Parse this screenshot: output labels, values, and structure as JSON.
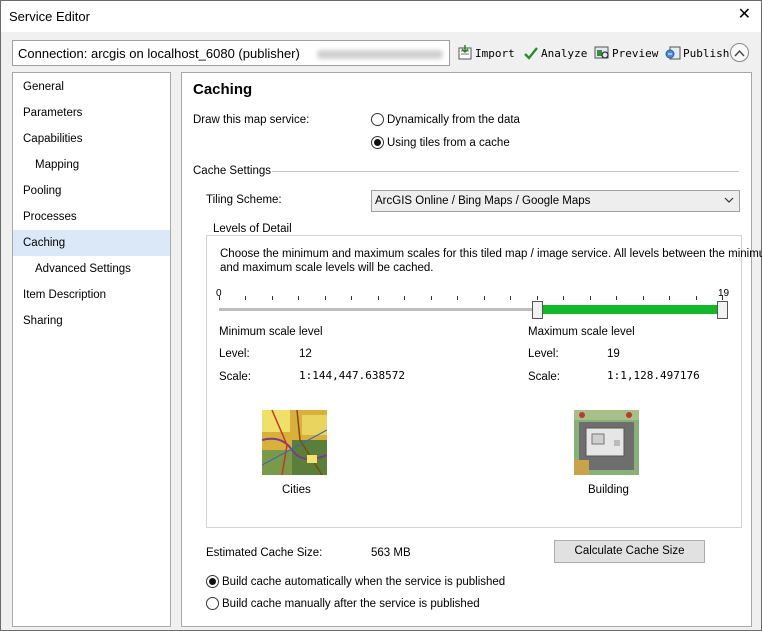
{
  "window": {
    "title": "Service Editor"
  },
  "connection": {
    "label": "Connection: arcgis on localhost_6080 (publisher)"
  },
  "toolbar": {
    "import_label": "Import",
    "analyze_label": "Analyze",
    "preview_label": "Preview",
    "publish_label": "Publish"
  },
  "nav": {
    "items": [
      {
        "label": "General"
      },
      {
        "label": "Parameters"
      },
      {
        "label": "Capabilities"
      },
      {
        "label": "Mapping"
      },
      {
        "label": "Pooling"
      },
      {
        "label": "Processes"
      },
      {
        "label": "Caching"
      },
      {
        "label": "Advanced Settings"
      },
      {
        "label": "Item Description"
      },
      {
        "label": "Sharing"
      }
    ],
    "selected": "Caching"
  },
  "caching": {
    "heading": "Caching",
    "draw_label": "Draw this map service:",
    "draw_options": [
      {
        "label": "Dynamically from the data",
        "checked": false
      },
      {
        "label": "Using tiles from a cache",
        "checked": true
      }
    ],
    "cache_settings_label": "Cache Settings",
    "tiling_scheme_label": "Tiling Scheme:",
    "tiling_scheme_value": "ArcGIS Online / Bing Maps / Google Maps",
    "lod": {
      "title": "Levels of Detail",
      "description_line1": "Choose the minimum and maximum scales for this tiled map / image service. All levels between the minimum",
      "description_line2": "and maximum scale levels will be cached.",
      "slider": {
        "min": 0,
        "max": 19,
        "low": 12,
        "high": 19,
        "min_label": "0",
        "max_label": "19"
      },
      "minimum": {
        "title": "Minimum scale level",
        "level_label": "Level:",
        "level_value": "12",
        "scale_label": "Scale:",
        "scale_value": "1:144,447.638572",
        "image_caption": "Cities"
      },
      "maximum": {
        "title": "Maximum scale level",
        "level_label": "Level:",
        "level_value": "19",
        "scale_label": "Scale:",
        "scale_value": "1:1,128.497176",
        "image_caption": "Building"
      }
    },
    "estimated_label": "Estimated Cache Size:",
    "estimated_value": "563 MB",
    "calculate_button": "Calculate Cache Size",
    "build_options": [
      {
        "label": "Build cache automatically when the service is published",
        "checked": true
      },
      {
        "label": "Build cache manually after the service is published",
        "checked": false
      }
    ]
  },
  "colors": {
    "slider_fill": "#11b92b",
    "nav_selected": "#dbe8f7"
  },
  "icons": [
    "close-icon",
    "import-icon",
    "analyze-check-icon",
    "preview-icon",
    "publish-icon",
    "collapse-chevron-icon",
    "dropdown-chevron-icon"
  ]
}
